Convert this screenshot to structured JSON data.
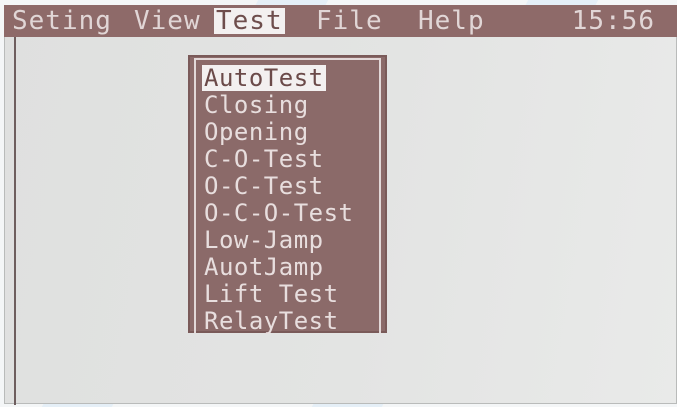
{
  "menubar": {
    "items": [
      {
        "label": "Seting"
      },
      {
        "label": "View"
      },
      {
        "label": "Test",
        "active": true
      },
      {
        "label": "File"
      },
      {
        "label": "Help"
      }
    ],
    "clock": "15:56"
  },
  "test_menu": {
    "items": [
      {
        "label": "AutoTest",
        "selected": true
      },
      {
        "label": "Closing"
      },
      {
        "label": "Opening"
      },
      {
        "label": "C-O-Test"
      },
      {
        "label": "O-C-Test"
      },
      {
        "label": "O-C-O-Test"
      },
      {
        "label": "Low-Jamp"
      },
      {
        "label": "AuotJamp"
      },
      {
        "label": "Lift Test"
      },
      {
        "label": "RelayTest"
      }
    ]
  },
  "colors": {
    "menubar_bg": "#8e6a69",
    "menu_text": "#e1d6d6",
    "highlight_bg": "#f3f0f0",
    "screen_bg": "#e3e4e3"
  }
}
